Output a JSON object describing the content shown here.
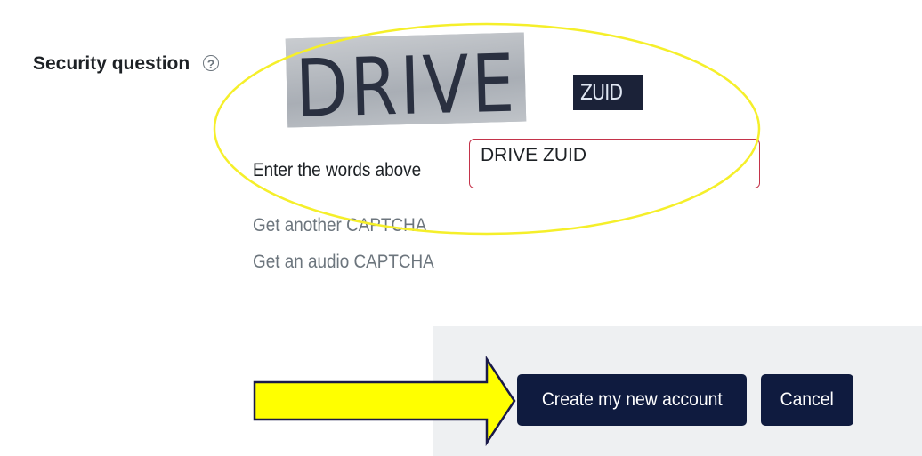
{
  "security": {
    "label": "Security question",
    "help_icon": "question-circle-icon",
    "help_glyph": "?"
  },
  "captcha": {
    "word_1": "DRIVE",
    "word_2": "ZUID",
    "prompt": "Enter the words above",
    "input_value": "DRIVE ZUID",
    "get_another": "Get another CAPTCHA",
    "get_audio": "Get an audio CAPTCHA"
  },
  "actions": {
    "create_label": "Create my new account",
    "cancel_label": "Cancel"
  },
  "annotations": {
    "ellipse_color": "#f5ef2a",
    "arrow_color": "#ffff00",
    "arrow_outline": "#1a1a4a"
  },
  "colors": {
    "button_bg": "#0f1b3f",
    "input_border": "#c4334a",
    "link": "#6c757d"
  }
}
